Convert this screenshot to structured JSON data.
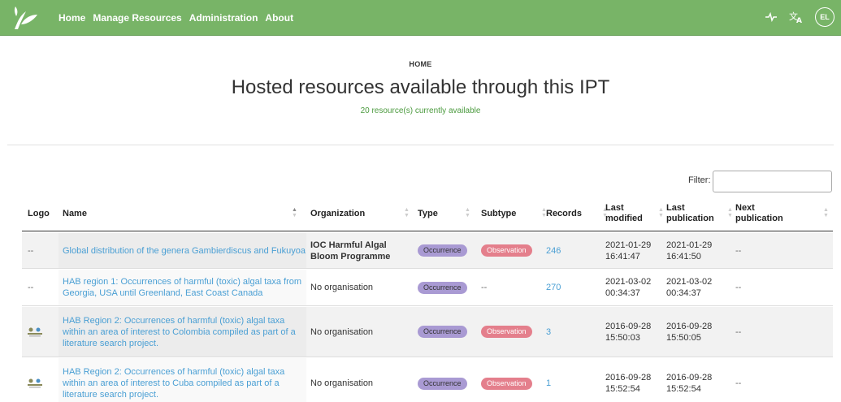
{
  "nav": {
    "links": [
      "Home",
      "Manage Resources",
      "Administration",
      "About"
    ],
    "avatar": "EL"
  },
  "header": {
    "breadcrumb": "HOME",
    "title": "Hosted resources available through this IPT",
    "subtitle": "20 resource(s) currently available"
  },
  "filter": {
    "label": "Filter:",
    "value": ""
  },
  "table": {
    "columns": [
      "Logo",
      "Name",
      "Organization",
      "Type",
      "Subtype",
      "Records",
      "Last modified",
      "Last publication",
      "Next publication"
    ],
    "rows": [
      {
        "logo": "--",
        "name": "Global distribution of the genera Gambierdiscus and Fukuyoa",
        "organization": "IOC Harmful Algal Bloom Programme",
        "type": "Occurrence",
        "subtype": "Observation",
        "records": "246",
        "last_modified": "2021-01-29 16:41:47",
        "last_publication": "2021-01-29 16:41:50",
        "next_publication": "--"
      },
      {
        "logo": "--",
        "name": "HAB region 1: Occurrences of harmful (toxic) algal taxa from Georgia, USA until Greenland, East Coast Canada",
        "organization": "No organisation",
        "type": "Occurrence",
        "subtype": "--",
        "records": "270",
        "last_modified": "2021-03-02 00:34:37",
        "last_publication": "2021-03-02 00:34:37",
        "next_publication": "--"
      },
      {
        "logo": "image",
        "name": "HAB Region 2: Occurrences of harmful (toxic) algal taxa within an area of interest to Colombia compiled as part of a literature search project.",
        "organization": "No organisation",
        "type": "Occurrence",
        "subtype": "Observation",
        "records": "3",
        "last_modified": "2016-09-28 15:50:03",
        "last_publication": "2016-09-28 15:50:05",
        "next_publication": "--"
      },
      {
        "logo": "image",
        "name": "HAB Region 2: Occurrences of harmful (toxic) algal taxa within an area of interest to Cuba compiled as part of a literature search project.",
        "organization": "No organisation",
        "type": "Occurrence",
        "subtype": "Observation",
        "records": "1",
        "last_modified": "2016-09-28 15:52:54",
        "last_publication": "2016-09-28 15:52:54",
        "next_publication": "--"
      }
    ]
  },
  "icons": [
    "leaf-logo-icon",
    "activity-icon",
    "translate-icon"
  ],
  "colors": {
    "navbar": "#78b467",
    "link": "#4a9fd4",
    "subtitle": "#4b9a3e",
    "occurrence_badge": "#a99ad3",
    "observation_badge": "#e47f8c"
  }
}
